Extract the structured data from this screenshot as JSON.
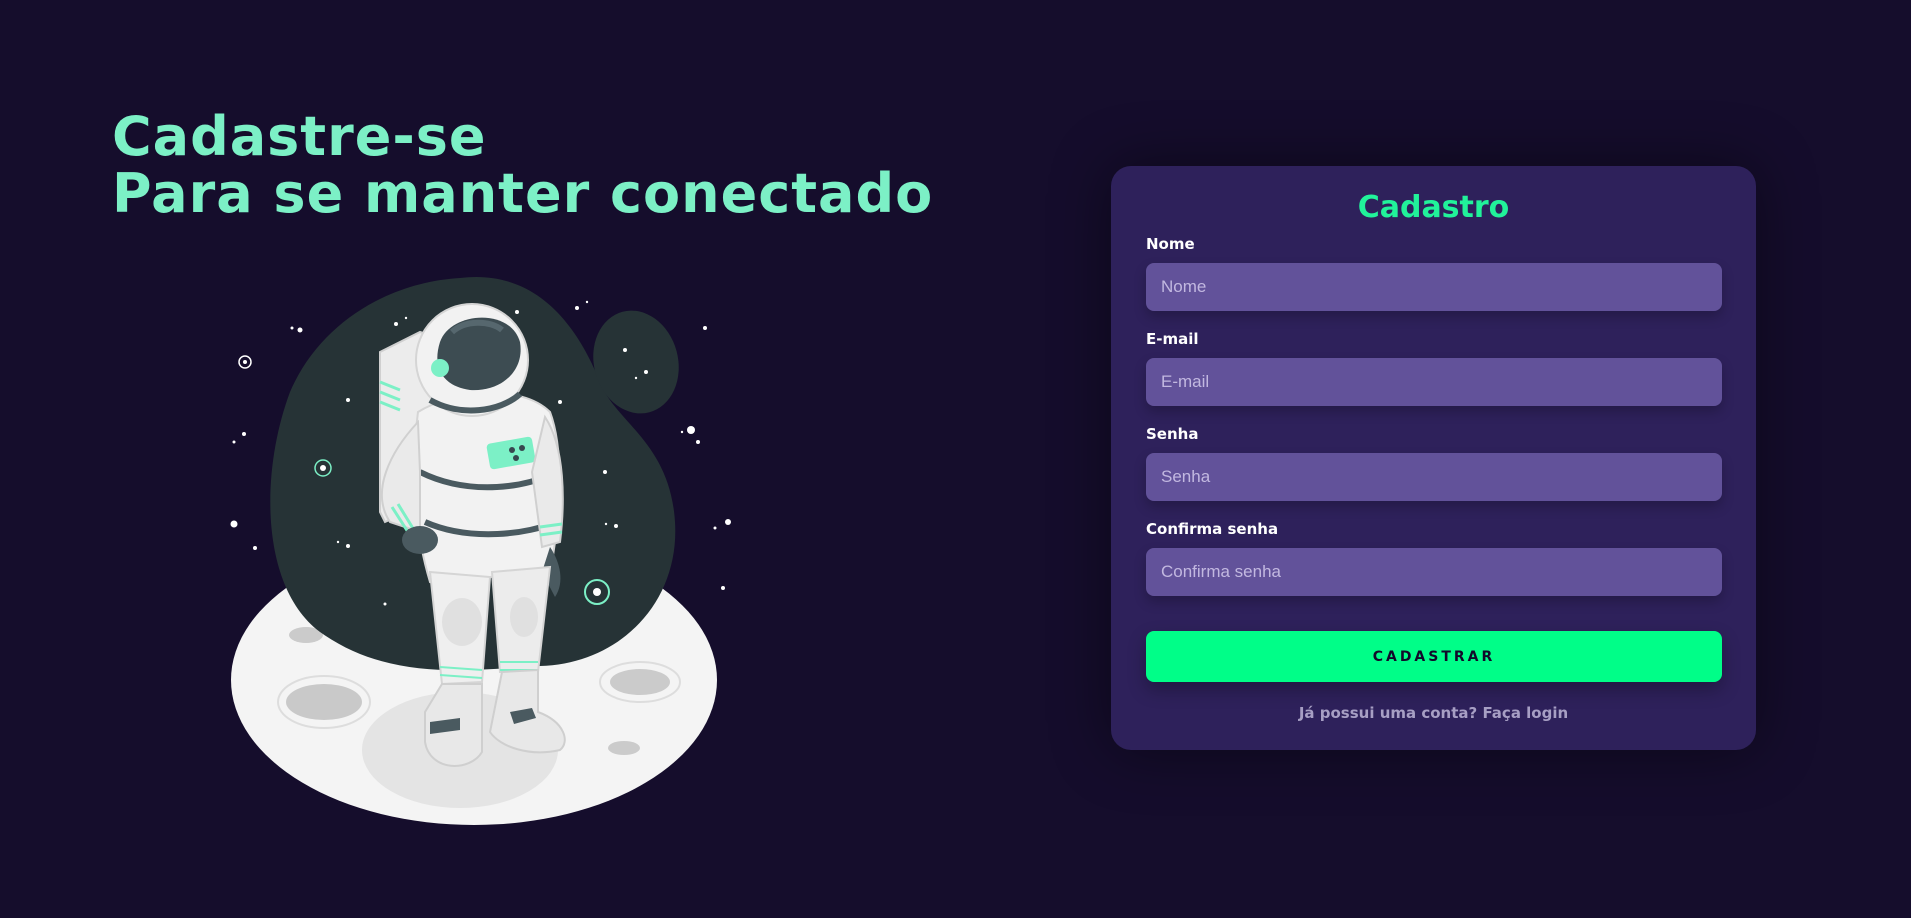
{
  "hero": {
    "line1": "Cadastre-se",
    "line2": "Para se manter conectado"
  },
  "illustration": {
    "subject": "astronaut-on-moon"
  },
  "form": {
    "title": "Cadastro",
    "fields": [
      {
        "label": "Nome",
        "placeholder": "Nome",
        "value": ""
      },
      {
        "label": "E-mail",
        "placeholder": "E-mail",
        "value": ""
      },
      {
        "label": "Senha",
        "placeholder": "Senha",
        "value": ""
      },
      {
        "label": "Confirma senha",
        "placeholder": "Confirma senha",
        "value": ""
      }
    ],
    "submit_label": "CADASTRAR",
    "login_text": "Já possui uma conta? Faça login"
  },
  "colors": {
    "background": "#150d2c",
    "hero_text": "#7cf0c6",
    "card": "#2e215b",
    "input": "#62529a",
    "accent": "#00fe88"
  }
}
